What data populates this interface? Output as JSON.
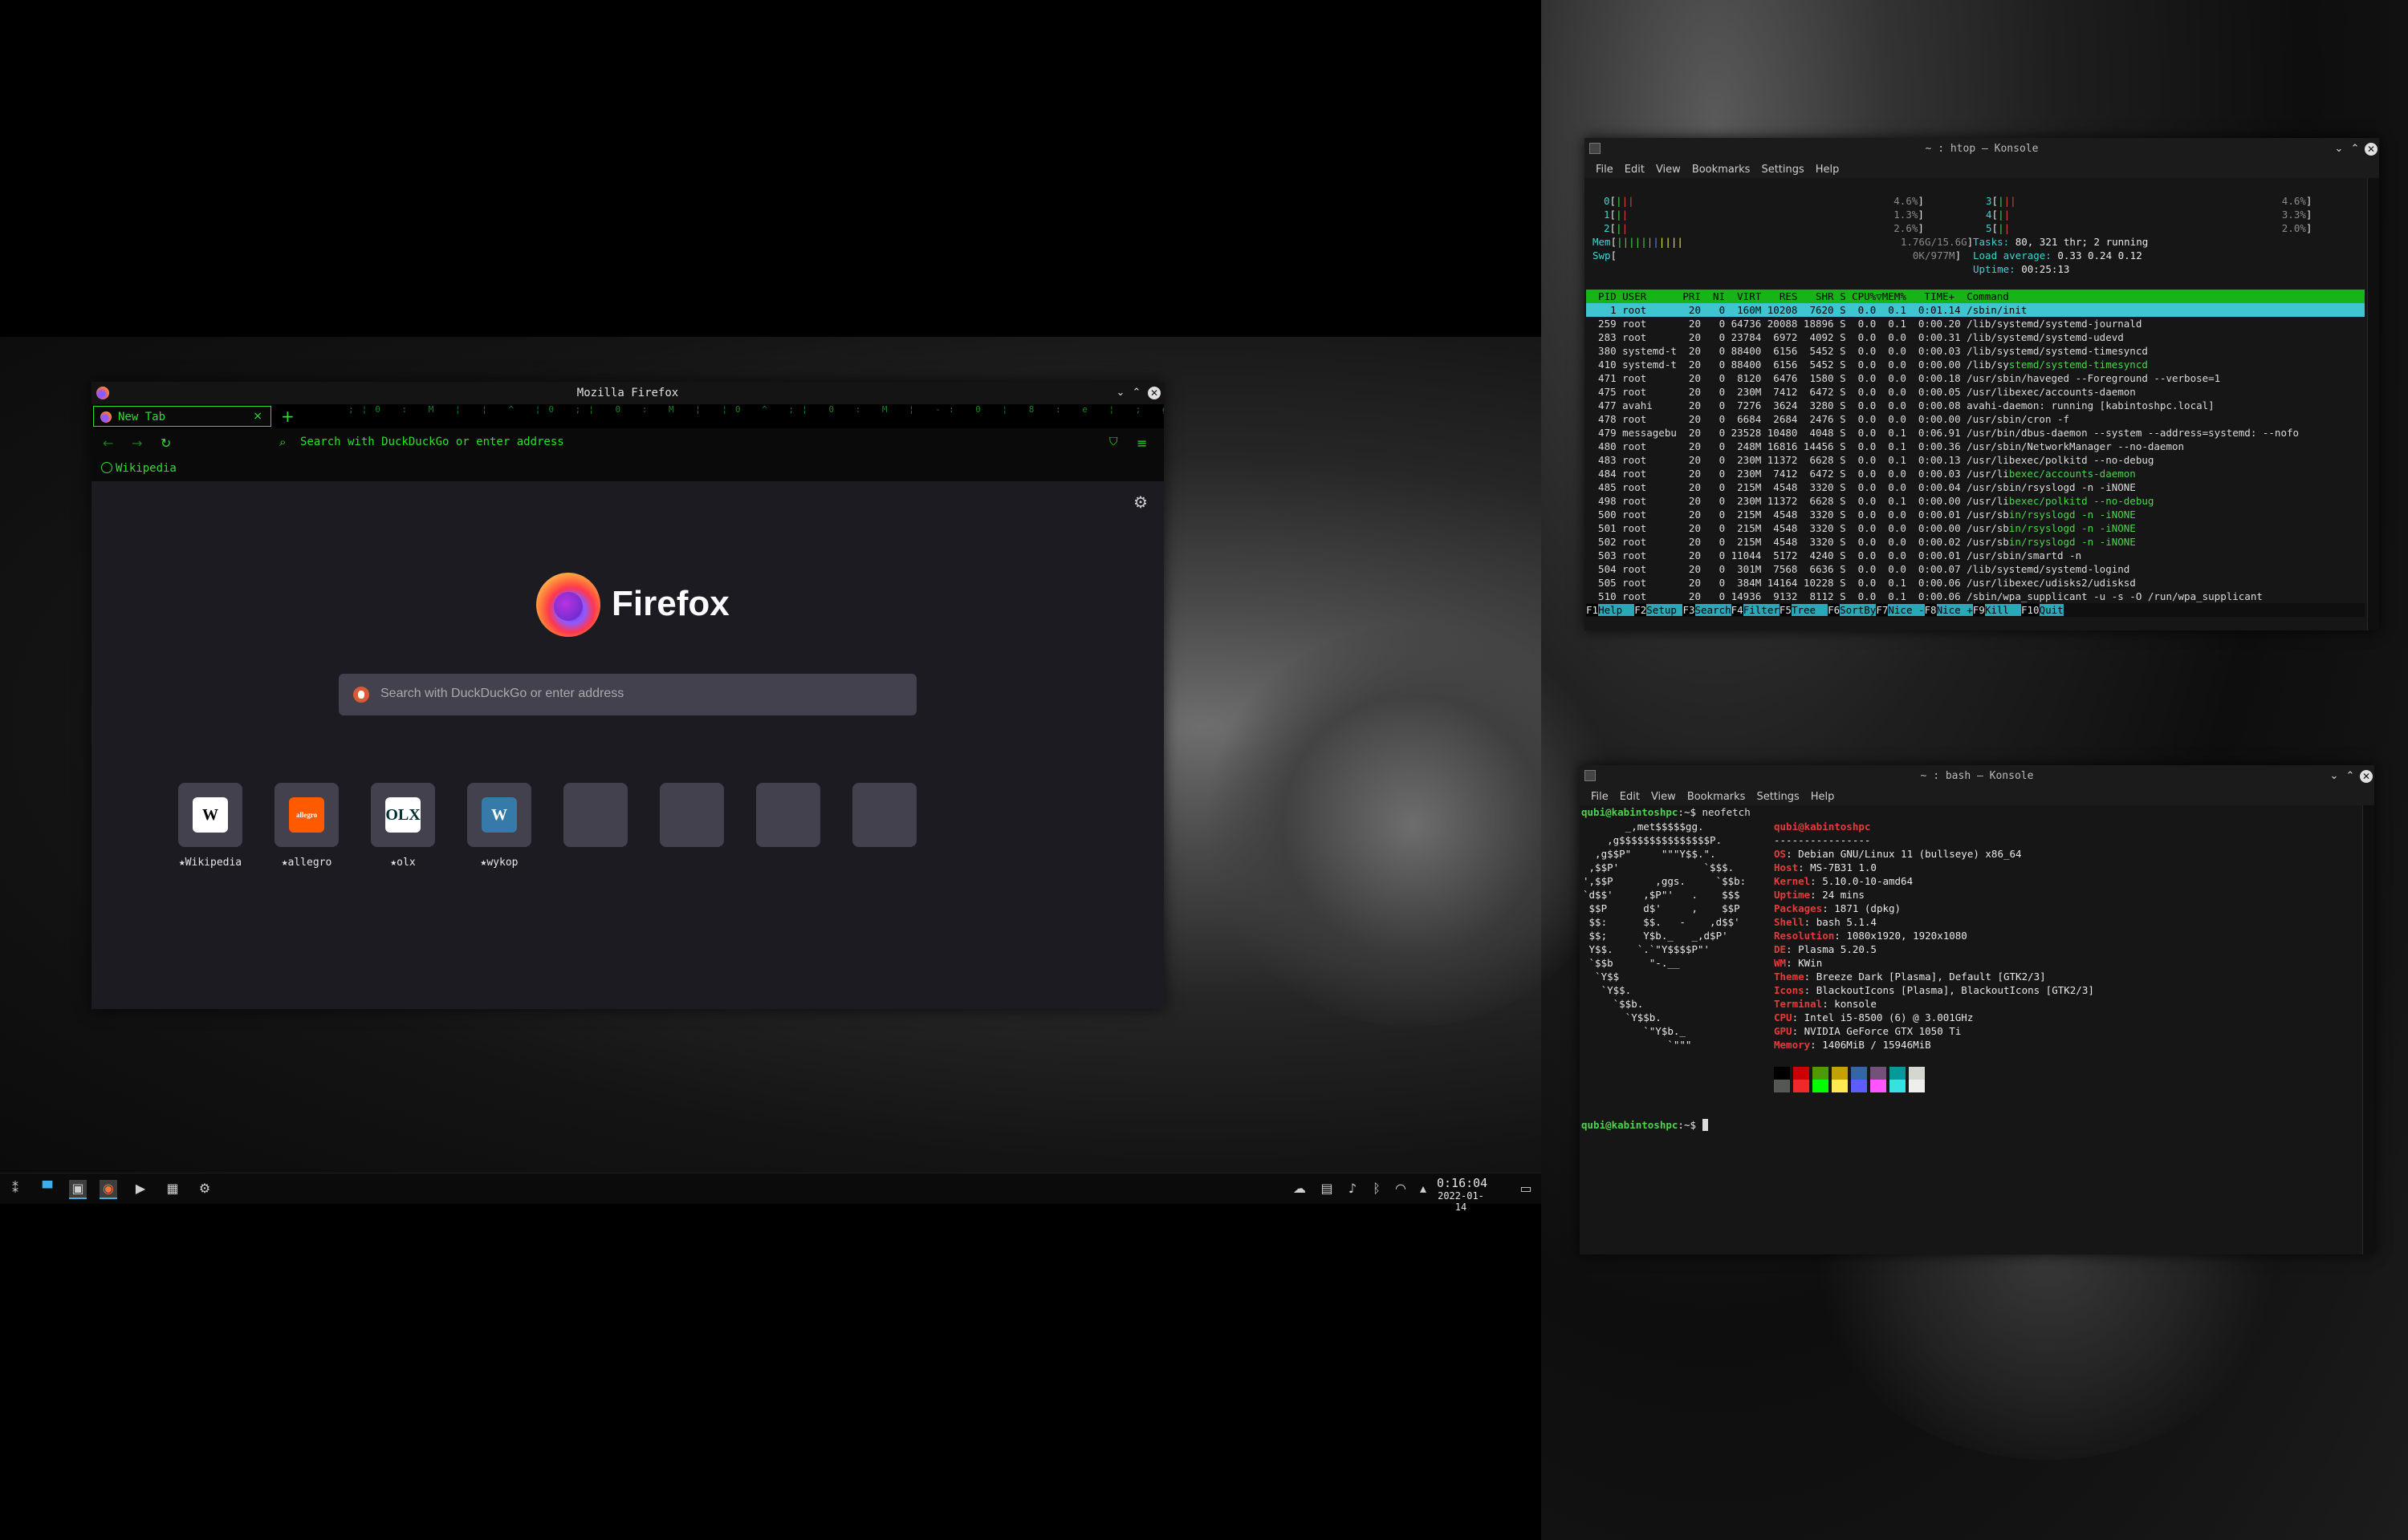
{
  "firefox": {
    "window_title": "Mozilla Firefox",
    "tab_label": "New Tab",
    "url_placeholder": "Search with DuckDuckGo or enter address",
    "bookmark": "Wikipedia",
    "brand": "Firefox",
    "search_placeholder": "Search with DuckDuckGo or enter address",
    "shortcuts": [
      {
        "label": "★Wikipedia",
        "glyph": "W",
        "bg": "#ffffff",
        "fg": "#000000"
      },
      {
        "label": "★allegro",
        "glyph": "allegro",
        "bg": "#ff5a00",
        "fg": "#ffffff"
      },
      {
        "label": "★olx",
        "glyph": "OLX",
        "bg": "#ffffff",
        "fg": "#002f34"
      },
      {
        "label": "★wykop",
        "glyph": "W",
        "bg": "#367aa9",
        "fg": "#ffffff"
      }
    ],
    "accent_color": "#2ae02a"
  },
  "taskbar": {
    "time": "0:16:04",
    "date": "2022-01-14"
  },
  "htop_window": {
    "title": "~ : htop — Konsole",
    "menu": [
      "File",
      "Edit",
      "View",
      "Bookmarks",
      "Settings",
      "Help"
    ],
    "cpu_left": [
      {
        "id": "0",
        "pct": "4.6%"
      },
      {
        "id": "1",
        "pct": "1.3%"
      },
      {
        "id": "2",
        "pct": "2.6%"
      }
    ],
    "cpu_right": [
      {
        "id": "3",
        "pct": "4.6%"
      },
      {
        "id": "4",
        "pct": "3.3%"
      },
      {
        "id": "5",
        "pct": "2.0%"
      }
    ],
    "mem": "1.76G/15.6G",
    "swp": "0K/977M",
    "tasks_label": "Tasks:",
    "tasks": "80, 321 thr; 2 running",
    "load_label": "Load average:",
    "load": "0.33 0.24 0.12",
    "uptime_label": "Uptime:",
    "uptime": "00:25:13",
    "header": "  PID USER      PRI  NI  VIRT   RES   SHR S CPU%▽MEM%   TIME+  Command",
    "selected_row": "    1 root       20   0  160M 10208  7620 S  0.0  0.1  0:01.14 /sbin/init",
    "rows": [
      "  259 root       20   0 64736 20088 18896 S  0.0  0.1  0:00.20 /lib/systemd/systemd-journald",
      "  283 root       20   0 23784  6972  4092 S  0.0  0.0  0:00.31 /lib/systemd/systemd-udevd",
      "  380 systemd-t  20   0 88400  6156  5452 S  0.0  0.0  0:00.03 /lib/systemd/systemd-timesyncd",
      "  410 systemd-t  20   0 88400  6156  5452 S  0.0  0.0  0:00.00 /lib/systemd/systemd-timesyncd",
      "  471 root       20   0  8120  6476  1580 S  0.0  0.0  0:00.18 /usr/sbin/haveged --Foreground --verbose=1",
      "  475 root       20   0  230M  7412  6472 S  0.0  0.0  0:00.05 /usr/libexec/accounts-daemon",
      "  477 avahi      20   0  7276  3624  3280 S  0.0  0.0  0:00.08 avahi-daemon: running [kabintoshpc.local]",
      "  478 root       20   0  6684  2684  2476 S  0.0  0.0  0:00.00 /usr/sbin/cron -f",
      "  479 messagebu  20   0 23528 10480  4048 S  0.0  0.1  0:06.91 /usr/bin/dbus-daemon --system --address=systemd: --nofo",
      "  480 root       20   0  248M 16816 14456 S  0.0  0.1  0:00.36 /usr/sbin/NetworkManager --no-daemon",
      "  483 root       20   0  230M 11372  6628 S  0.0  0.1  0:00.13 /usr/libexec/polkitd --no-debug",
      "  484 root       20   0  230M  7412  6472 S  0.0  0.0  0:00.03 /usr/libexec/accounts-daemon",
      "  485 root       20   0  215M  4548  3320 S  0.0  0.0  0:00.04 /usr/sbin/rsyslogd -n -iNONE",
      "  498 root       20   0  230M 11372  6628 S  0.0  0.1  0:00.00 /usr/libexec/polkitd --no-debug",
      "  500 root       20   0  215M  4548  3320 S  0.0  0.0  0:00.01 /usr/sbin/rsyslogd -n -iNONE",
      "  501 root       20   0  215M  4548  3320 S  0.0  0.0  0:00.00 /usr/sbin/rsyslogd -n -iNONE",
      "  502 root       20   0  215M  4548  3320 S  0.0  0.0  0:00.02 /usr/sbin/rsyslogd -n -iNONE",
      "  503 root       20   0 11044  5172  4240 S  0.0  0.0  0:00.01 /usr/sbin/smartd -n",
      "  504 root       20   0  301M  7568  6636 S  0.0  0.0  0:00.07 /lib/systemd/systemd-logind",
      "  505 root       20   0  384M 14164 10228 S  0.0  0.1  0:00.06 /usr/libexec/udisks2/udisksd",
      "  510 root       20   0 14936  9132  8112 S  0.0  0.1  0:00.06 /sbin/wpa_supplicant -u -s -O /run/wpa_supplicant"
    ],
    "fkeys": [
      {
        "k": "F1",
        "v": "Help  "
      },
      {
        "k": "F2",
        "v": "Setup "
      },
      {
        "k": "F3",
        "v": "Search"
      },
      {
        "k": "F4",
        "v": "Filter"
      },
      {
        "k": "F5",
        "v": "Tree  "
      },
      {
        "k": "F6",
        "v": "SortBy"
      },
      {
        "k": "F7",
        "v": "Nice -"
      },
      {
        "k": "F8",
        "v": "Nice +"
      },
      {
        "k": "F9",
        "v": "Kill  "
      },
      {
        "k": "F10",
        "v": "Quit"
      }
    ]
  },
  "bash_window": {
    "title": "~ : bash — Konsole",
    "menu": [
      "File",
      "Edit",
      "View",
      "Bookmarks",
      "Settings",
      "Help"
    ],
    "prompt": "qubi@kabintoshpc",
    "prompt_suffix": ":~$",
    "command": " neofetch",
    "user_host": "qubi@kabintoshpc",
    "separator": "----------------",
    "art": [
      "       _,met$$$$$gg.",
      "    ,g$$$$$$$$$$$$$$$P.",
      "  ,g$$P\"     \"\"\"Y$$.\".",
      " ,$$P'              `$$$.",
      "',$$P       ,ggs.     `$$b:",
      "`d$$'     ,$P\"'   .    $$$",
      " $$P      d$'     ,    $$P",
      " $$:      $$.   -    ,d$$'",
      " $$;      Y$b._   _,d$P'",
      " Y$$.    `.`\"Y$$$$P\"'",
      " `$$b      \"-.__",
      "  `Y$$",
      "   `Y$$.",
      "     `$$b.",
      "       `Y$$b.",
      "          `\"Y$b._",
      "              `\"\"\""
    ],
    "info": [
      {
        "k": "OS",
        "v": "Debian GNU/Linux 11 (bullseye) x86_64"
      },
      {
        "k": "Host",
        "v": "MS-7B31 1.0"
      },
      {
        "k": "Kernel",
        "v": "5.10.0-10-amd64"
      },
      {
        "k": "Uptime",
        "v": "24 mins"
      },
      {
        "k": "Packages",
        "v": "1871 (dpkg)"
      },
      {
        "k": "Shell",
        "v": "bash 5.1.4"
      },
      {
        "k": "Resolution",
        "v": "1080x1920, 1920x1080"
      },
      {
        "k": "DE",
        "v": "Plasma 5.20.5"
      },
      {
        "k": "WM",
        "v": "KWin"
      },
      {
        "k": "Theme",
        "v": "Breeze Dark [Plasma], Default [GTK2/3]"
      },
      {
        "k": "Icons",
        "v": "BlackoutIcons [Plasma], BlackoutIcons [GTK2/3]"
      },
      {
        "k": "Terminal",
        "v": "konsole"
      },
      {
        "k": "CPU",
        "v": "Intel i5-8500 (6) @ 3.001GHz"
      },
      {
        "k": "GPU",
        "v": "NVIDIA GeForce GTX 1050 Ti"
      },
      {
        "k": "Memory",
        "v": "1406MiB / 15946MiB"
      }
    ],
    "palette_top": [
      "#000000",
      "#cc0000",
      "#4e9a06",
      "#c4a000",
      "#3465a4",
      "#75507b",
      "#06989a",
      "#d3d7cf"
    ],
    "palette_bottom": [
      "#555753",
      "#ef2929",
      "#00ff00",
      "#fce94f",
      "#5c5cff",
      "#ff55ff",
      "#34e2e2",
      "#eeeeec"
    ]
  }
}
